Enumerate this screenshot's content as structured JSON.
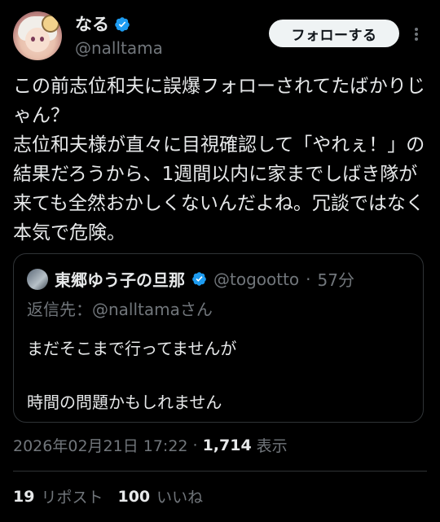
{
  "colors": {
    "background": "#000000",
    "text": "#e7e9ea",
    "muted": "#71767b",
    "verified": "#1d9bf0",
    "border": "#2f3336"
  },
  "author": {
    "name": "なる",
    "handle": "@nalltama",
    "verified_icon": "verified-badge-icon",
    "follow_label": "フォローする",
    "more_icon": "more-dots-icon"
  },
  "tweet": {
    "text": "この前志位和夫に誤爆フォローされてたばかりじゃん？\n志位和夫様が直々に目視確認して「やれぇ！」の結果だろうから、1週間以内に家までしばき隊が来ても全然おかしくないんだよね。冗談ではなく本気で危険。",
    "timestamp": "2026年02月21日 17:22",
    "views_count": "1,714",
    "views_label": "表示"
  },
  "quote": {
    "name": "東郷ゆう子の旦那",
    "handle": "@togootto",
    "time": "57分",
    "reply_to": "返信先：@nalltamaさん",
    "line1": "まだそこまで行ってませんが",
    "line2": "時間の問題かもしれません"
  },
  "stats": {
    "reposts_count": "19",
    "reposts_label": "リポスト",
    "likes_count": "100",
    "likes_label": "いいね"
  }
}
